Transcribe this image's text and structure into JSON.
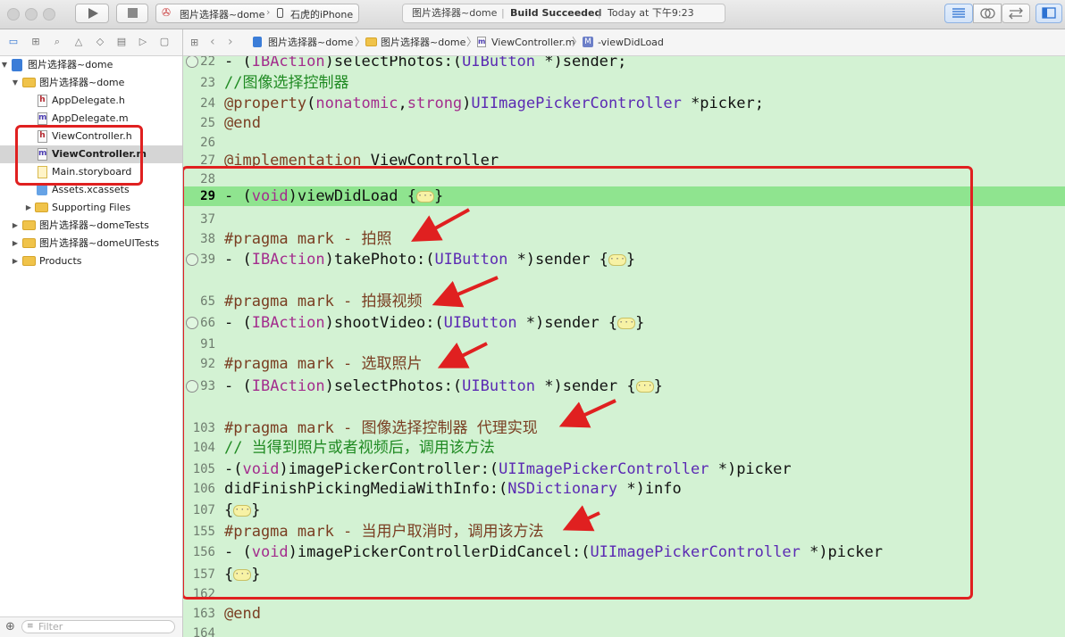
{
  "toolbar": {
    "scheme": "图片选择器~dome",
    "device": "石虎的iPhone",
    "status_project": "图片选择器~dome",
    "status_build": "Build Succeeded",
    "status_time": "Today at 下午9:23"
  },
  "navigator": {
    "items": [
      {
        "label": "图片选择器~dome",
        "kind": "project"
      },
      {
        "label": "图片选择器~dome",
        "kind": "folder"
      },
      {
        "label": "AppDelegate.h",
        "kind": "h"
      },
      {
        "label": "AppDelegate.m",
        "kind": "m"
      },
      {
        "label": "ViewController.h",
        "kind": "h"
      },
      {
        "label": "ViewController.m",
        "kind": "m",
        "selected": true
      },
      {
        "label": "Main.storyboard",
        "kind": "storyboard"
      },
      {
        "label": "Assets.xcassets",
        "kind": "assets"
      },
      {
        "label": "Supporting Files",
        "kind": "folder"
      },
      {
        "label": "图片选择器~domeTests",
        "kind": "folder"
      },
      {
        "label": "图片选择器~domeUITests",
        "kind": "folder"
      },
      {
        "label": "Products",
        "kind": "folder"
      }
    ],
    "file_icon_letters": {
      "h": "h",
      "m": "m"
    },
    "filter_placeholder": "Filter"
  },
  "jumpbar": {
    "crumbs": [
      "图片选择器~dome",
      "图片选择器~dome",
      "ViewController.m",
      "-viewDidLoad"
    ],
    "method_badge": "M"
  },
  "editor": {
    "lines": [
      {
        "num": "22",
        "text": "- (IBAction)selectPhotos:(UIButton *)sender;",
        "breakpoint": true
      },
      {
        "num": "23",
        "text": "//图像选择控制器"
      },
      {
        "num": "24",
        "text": "@property(nonatomic,strong)UIImagePickerController *picker;"
      },
      {
        "num": "25",
        "text": "@end"
      },
      {
        "num": "26",
        "text": ""
      },
      {
        "num": "27",
        "text": "@implementation ViewController"
      },
      {
        "num": "28",
        "text": ""
      },
      {
        "num": "29",
        "text": "- (void)viewDidLoad {",
        "fold": true,
        "suffix": "}",
        "highlight": true
      },
      {
        "num": "37",
        "text": ""
      },
      {
        "num": "38",
        "text": "#pragma mark - 拍照"
      },
      {
        "num": "39",
        "text": "- (IBAction)takePhoto:(UIButton *)sender {",
        "fold": true,
        "suffix": "}",
        "breakpoint": true
      },
      {
        "num": "",
        "text": ""
      },
      {
        "num": "65",
        "text": "#pragma mark - 拍摄视频"
      },
      {
        "num": "66",
        "text": "- (IBAction)shootVideo:(UIButton *)sender {",
        "fold": true,
        "suffix": "}",
        "breakpoint": true
      },
      {
        "num": "91",
        "text": ""
      },
      {
        "num": "92",
        "text": "#pragma mark - 选取照片"
      },
      {
        "num": "93",
        "text": "- (IBAction)selectPhotos:(UIButton *)sender {",
        "fold": true,
        "suffix": "}",
        "breakpoint": true
      },
      {
        "num": "",
        "text": ""
      },
      {
        "num": "103",
        "text": "#pragma mark - 图像选择控制器 代理实现"
      },
      {
        "num": "104",
        "text": "// 当得到照片或者视频后，调用该方法"
      },
      {
        "num": "105",
        "text": "-(void)imagePickerController:(UIImagePickerController *)picker"
      },
      {
        "num": "106",
        "text": "didFinishPickingMediaWithInfo:(NSDictionary *)info"
      },
      {
        "num": "107",
        "text": "",
        "fold": true,
        "prefix": "{",
        "suffix": "}"
      },
      {
        "num": "155",
        "text": "#pragma mark - 当用户取消时，调用该方法"
      },
      {
        "num": "156",
        "text": "- (void)imagePickerControllerDidCancel:(UIImagePickerController *)picker"
      },
      {
        "num": "157",
        "text": "",
        "fold": true,
        "prefix": "{",
        "suffix": "}"
      },
      {
        "num": "162",
        "text": ""
      },
      {
        "num": "163",
        "text": "@end"
      },
      {
        "num": "164",
        "text": ""
      }
    ],
    "fold_glyph": "···"
  },
  "colors": {
    "editor_bg": "#d3f2d3",
    "current_line": "#8fe48f",
    "annotation_red": "#e02020"
  }
}
